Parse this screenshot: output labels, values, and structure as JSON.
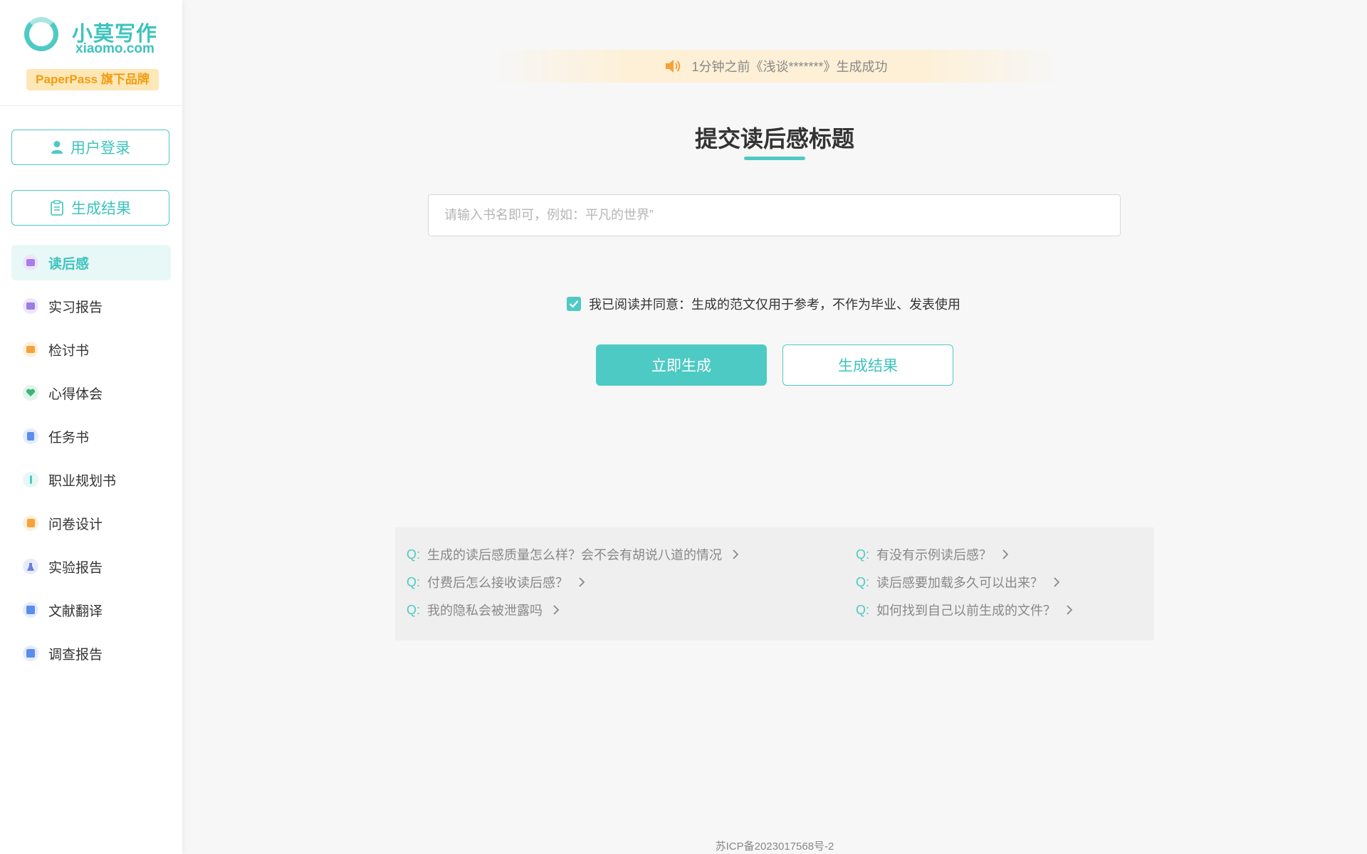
{
  "brand": {
    "name": "小莫写作",
    "domain": "xiaomo.com",
    "badge": "PaperPass 旗下品牌",
    "accent_color": "#4ecac4"
  },
  "sidebar": {
    "login_button": {
      "label": "用户登录",
      "icon": "user-icon"
    },
    "results_button": {
      "label": "生成结果",
      "icon": "clipboard-icon"
    },
    "nav": [
      {
        "label": "读后感",
        "icon": "chat-icon",
        "color": "#a77ee8",
        "active": true
      },
      {
        "label": "实习报告",
        "icon": "monitor-icon",
        "color": "#9b7be6"
      },
      {
        "label": "检讨书",
        "icon": "envelope-icon",
        "color": "#f5a23a"
      },
      {
        "label": "心得体会",
        "icon": "heart-icon",
        "color": "#3fb37a"
      },
      {
        "label": "任务书",
        "icon": "clipboard-icon",
        "color": "#5b8def"
      },
      {
        "label": "职业规划书",
        "icon": "info-icon",
        "color": "#4ecac4"
      },
      {
        "label": "问卷设计",
        "icon": "question-icon",
        "color": "#f5a23a"
      },
      {
        "label": "实验报告",
        "icon": "flask-icon",
        "color": "#6a7fe0"
      },
      {
        "label": "文献翻译",
        "icon": "translate-icon",
        "color": "#5b8def"
      },
      {
        "label": "调查报告",
        "icon": "checklist-icon",
        "color": "#5b8def"
      }
    ]
  },
  "notice": {
    "text": "1分钟之前《浅谈*******》生成成功",
    "icon": "speaker-icon"
  },
  "main": {
    "title": "提交读后感标题",
    "input_placeholder": "请输入书名即可，例如：平凡的世界”",
    "input_value": "",
    "agree_checked": true,
    "agree_text": "我已阅读并同意：生成的范文仅用于参考，不作为毕业、发表使用",
    "generate_button": "立即生成",
    "results_button": "生成结果"
  },
  "faq": {
    "prefix": "Q:",
    "items": [
      "生成的读后感质量怎么样？会不会有胡说八道的情况",
      "付费后怎么接收读后感？",
      "我的隐私会被泄露吗",
      "有没有示例读后感？",
      "读后感要加载多久可以出来？",
      "如何找到自己以前生成的文件？"
    ]
  },
  "footer": {
    "icp": "苏ICP备2023017568号-2"
  }
}
